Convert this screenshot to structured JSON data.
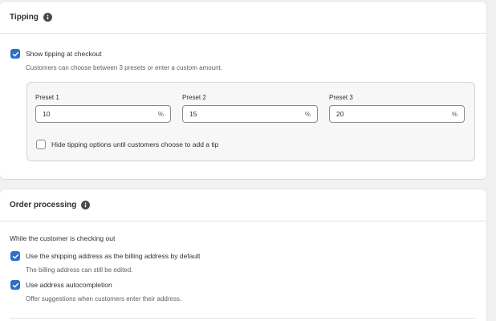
{
  "tipping": {
    "title": "Tipping",
    "show_tipping": {
      "label": "Show tipping at checkout",
      "checked": true,
      "help": "Customers can choose between 3 presets or enter a custom amount."
    },
    "presets": [
      {
        "label": "Preset 1",
        "value": "10",
        "suffix": "%"
      },
      {
        "label": "Preset 2",
        "value": "15",
        "suffix": "%"
      },
      {
        "label": "Preset 3",
        "value": "20",
        "suffix": "%"
      }
    ],
    "hide_option": {
      "label": "Hide tipping options until customers choose to add a tip",
      "checked": false
    }
  },
  "order_processing": {
    "title": "Order processing",
    "intro": "While the customer is checking out",
    "shipping_as_billing": {
      "label": "Use the shipping address as the billing address by default",
      "checked": true,
      "help": "The billing address can still be edited."
    },
    "autocompletion": {
      "label": "Use address autocompletion",
      "checked": true,
      "help": "Offer suggestions when customers enter their address."
    }
  },
  "colors": {
    "accent": "#2c6ecb",
    "background": "#f1f1f1",
    "card": "#ffffff",
    "subdued_text": "#616161"
  },
  "icons": [
    "info-icon",
    "checkmark-icon"
  ]
}
